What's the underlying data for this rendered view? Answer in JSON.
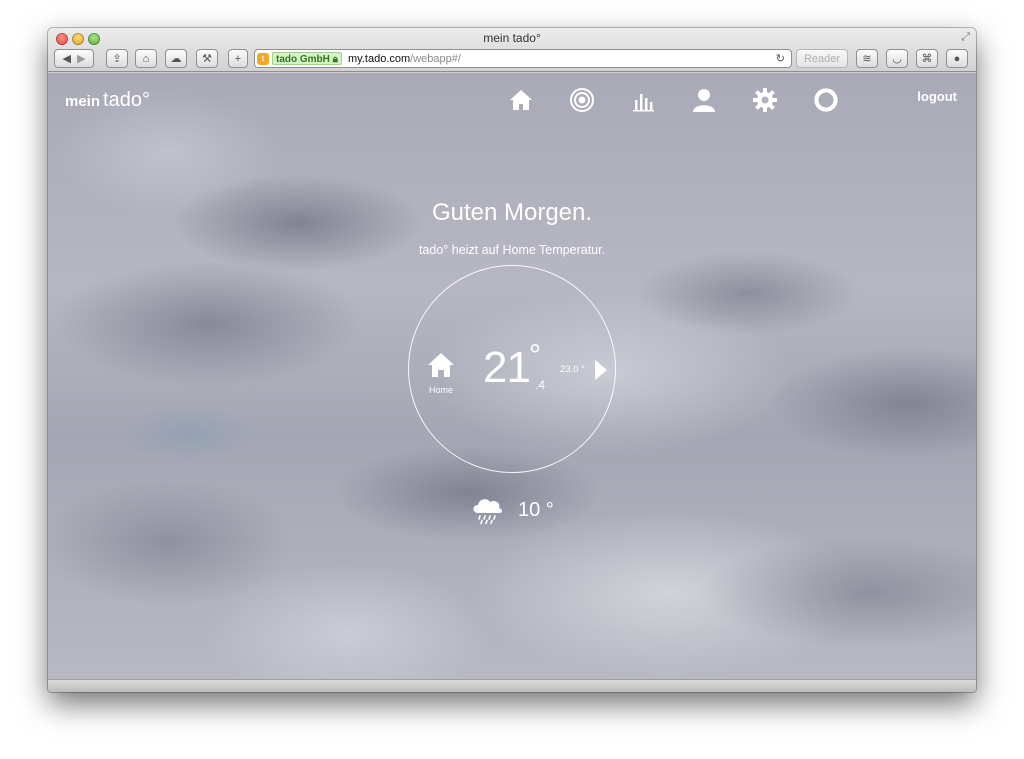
{
  "window": {
    "title": "mein tado°"
  },
  "browser": {
    "ev_label": "tado GmbH",
    "favicon_letter": "t",
    "url_host": "my.tado.com",
    "url_path": "/webapp#/",
    "reader_label": "Reader"
  },
  "app": {
    "logo_prefix": "mein",
    "logo_brand": "tado°",
    "logout_label": "logout",
    "nav": [
      "home-icon",
      "target-icon",
      "chart-icon",
      "user-icon",
      "gear-icon",
      "lifebuoy-icon"
    ]
  },
  "main": {
    "greeting": "Guten Morgen.",
    "status": "tado° heizt auf Home Temperatur.",
    "mode_label": "Home",
    "temp_integer": "21",
    "temp_degree": "°",
    "temp_decimal": ".4",
    "target_temp": "23.0 °",
    "weather_icon": "rain-cloud-icon",
    "outside_temp": "10 °"
  },
  "colors": {
    "text": "#ffffff",
    "ev_green": "#2e7a18",
    "favicon": "#f5a623"
  }
}
